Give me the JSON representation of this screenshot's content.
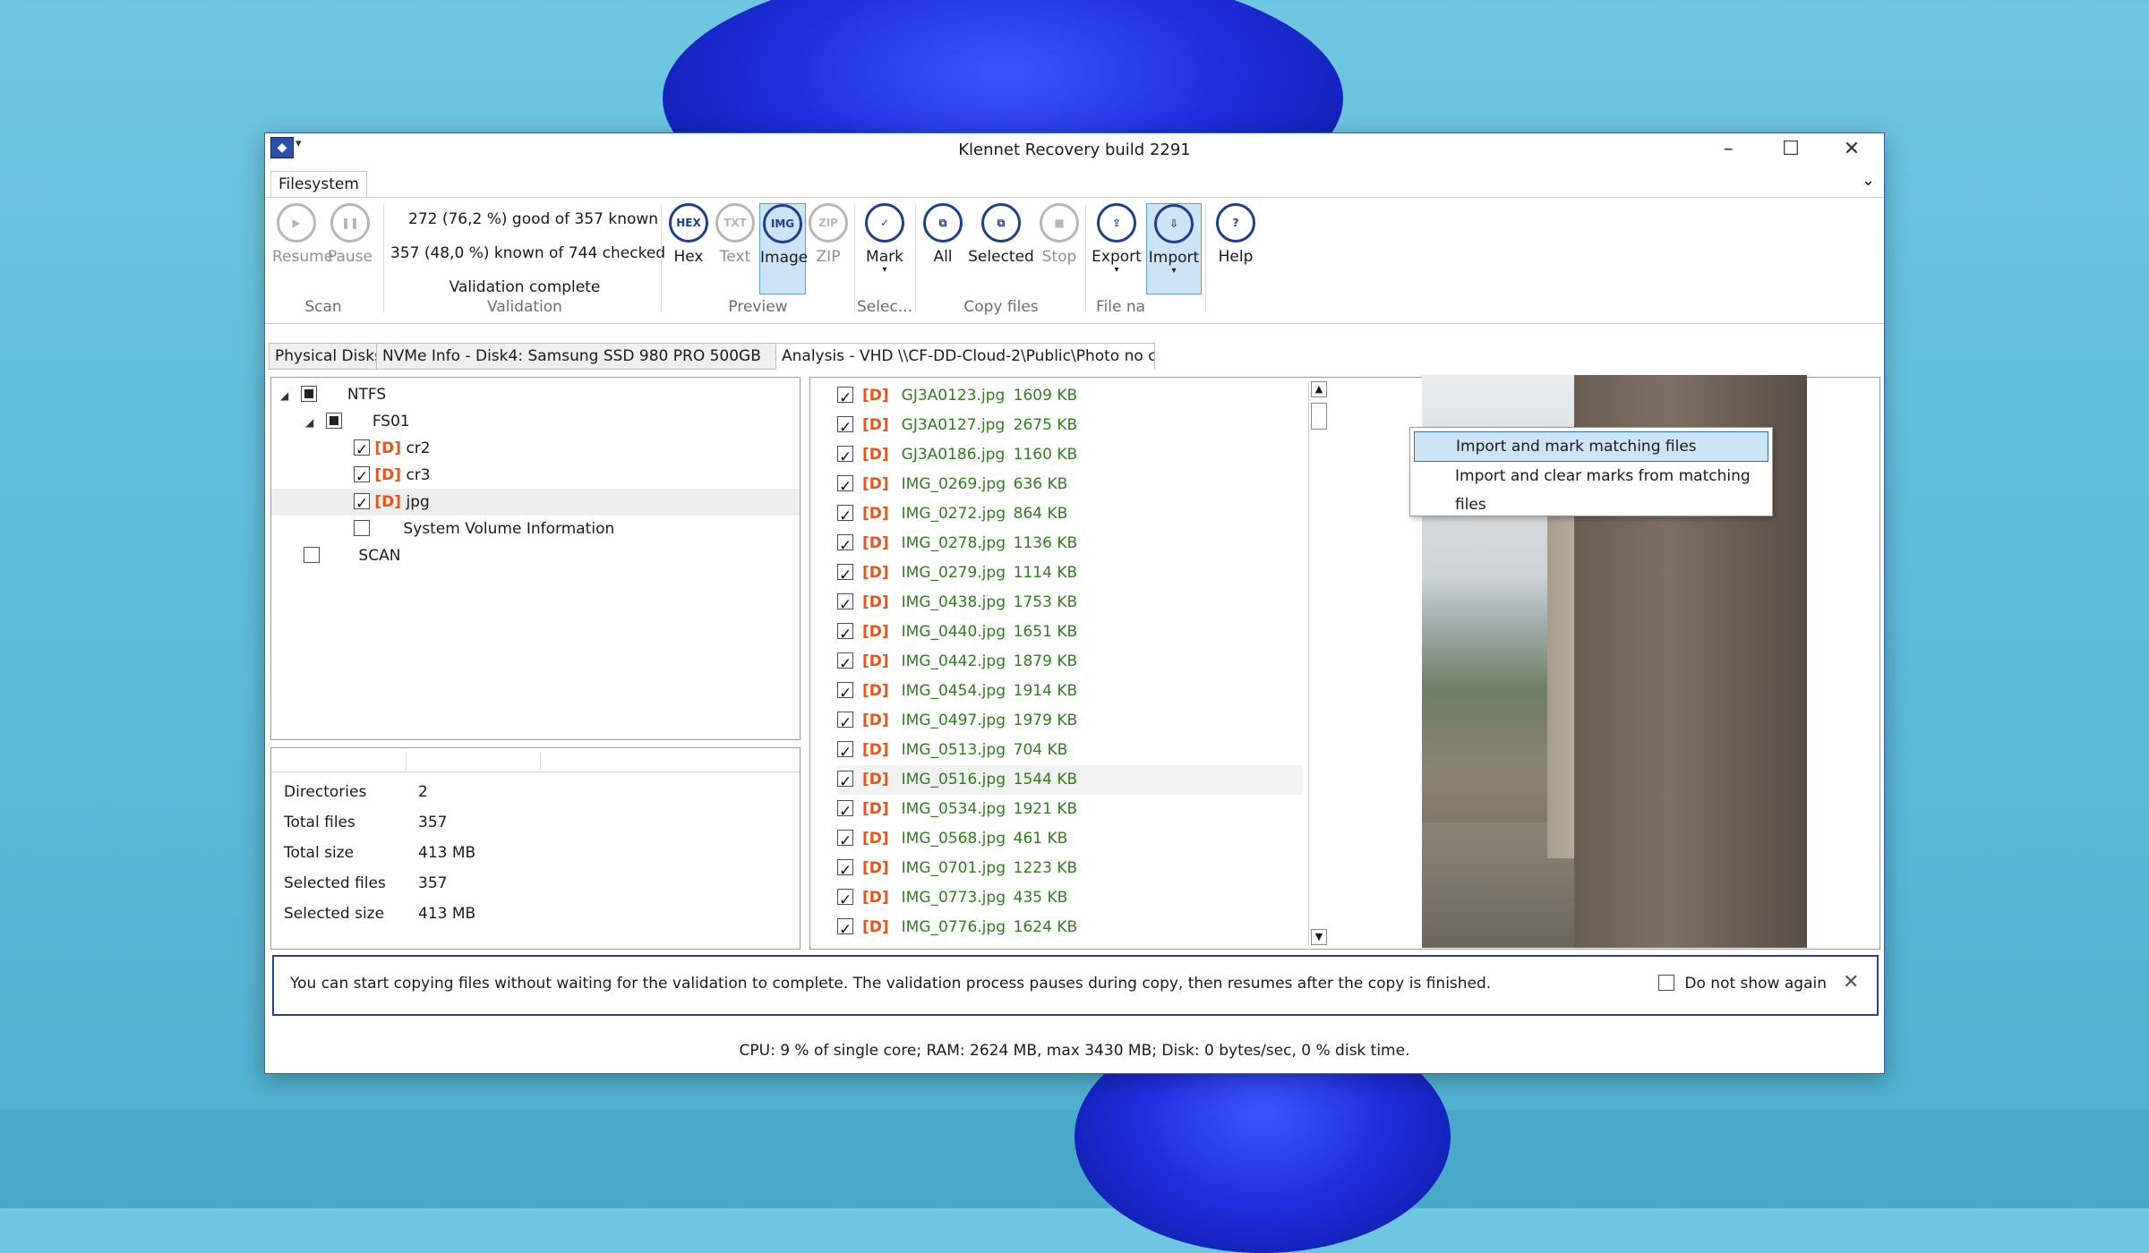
{
  "window": {
    "title": "Klennet Recovery build 2291"
  },
  "ribbon": {
    "tab": "Filesystem",
    "scan": {
      "resume": "Resume",
      "pause": "Pause",
      "group": "Scan"
    },
    "validation": {
      "line1": "272 (76,2 %) good of 357 known",
      "line2": "357 (48,0 %) known of 744 checked",
      "line3": "Validation complete",
      "group": "Validation"
    },
    "preview": {
      "hex": "Hex",
      "text": "Text",
      "image": "Image",
      "zip": "ZIP",
      "group": "Preview"
    },
    "select": {
      "mark": "Mark",
      "group": "Selec..."
    },
    "copy": {
      "all": "All",
      "selected": "Selected",
      "stop": "Stop",
      "group": "Copy files"
    },
    "file": {
      "export": "Export",
      "import": "Import",
      "group": "File na"
    },
    "help": "Help"
  },
  "import_menu": {
    "items": [
      "Import and mark matching files",
      "Import and clear marks from matching files"
    ]
  },
  "doctabs": [
    "Physical Disks",
    "NVMe Info - Disk4:  Samsung SSD 980 PRO 500GB",
    "Analysis - VHD \\\\CF-DD-Cloud-2\\Public\\Photo no c"
  ],
  "tree": {
    "tag": "[D]",
    "items": [
      {
        "label": "NTFS"
      },
      {
        "label": "FS01"
      },
      {
        "label": "cr2"
      },
      {
        "label": "cr3"
      },
      {
        "label": "jpg"
      },
      {
        "label": "System Volume Information"
      },
      {
        "label": "SCAN"
      }
    ]
  },
  "stats": [
    {
      "key": "Directories",
      "value": "2"
    },
    {
      "key": "Total files",
      "value": "357"
    },
    {
      "key": "Total size",
      "value": "413 MB"
    },
    {
      "key": "Selected files",
      "value": "357"
    },
    {
      "key": "Selected size",
      "value": "413 MB"
    }
  ],
  "files": {
    "tag": "[D]",
    "rows": [
      {
        "name": "GJ3A0123.jpg",
        "size": "1609 KB"
      },
      {
        "name": "GJ3A0127.jpg",
        "size": "2675 KB"
      },
      {
        "name": "GJ3A0186.jpg",
        "size": "1160 KB"
      },
      {
        "name": "IMG_0269.jpg",
        "size": "636 KB"
      },
      {
        "name": "IMG_0272.jpg",
        "size": "864 KB"
      },
      {
        "name": "IMG_0278.jpg",
        "size": "1136 KB"
      },
      {
        "name": "IMG_0279.jpg",
        "size": "1114 KB"
      },
      {
        "name": "IMG_0438.jpg",
        "size": "1753 KB"
      },
      {
        "name": "IMG_0440.jpg",
        "size": "1651 KB"
      },
      {
        "name": "IMG_0442.jpg",
        "size": "1879 KB"
      },
      {
        "name": "IMG_0454.jpg",
        "size": "1914 KB"
      },
      {
        "name": "IMG_0497.jpg",
        "size": "1979 KB"
      },
      {
        "name": "IMG_0513.jpg",
        "size": "704 KB"
      },
      {
        "name": "IMG_0516.jpg",
        "size": "1544 KB"
      },
      {
        "name": "IMG_0534.jpg",
        "size": "1921 KB"
      },
      {
        "name": "IMG_0568.jpg",
        "size": "461 KB"
      },
      {
        "name": "IMG_0701.jpg",
        "size": "1223 KB"
      },
      {
        "name": "IMG_0773.jpg",
        "size": "435 KB"
      },
      {
        "name": "IMG_0776.jpg",
        "size": "1624 KB"
      }
    ]
  },
  "infobar": {
    "text": "You can start copying files without waiting for the validation to complete. The validation process pauses during copy, then resumes after the copy is finished.",
    "checkbox": "Do not show again"
  },
  "status": "CPU: 9 % of single core; RAM: 2624 MB, max 3430 MB; Disk: 0 bytes/sec, 0 % disk time."
}
